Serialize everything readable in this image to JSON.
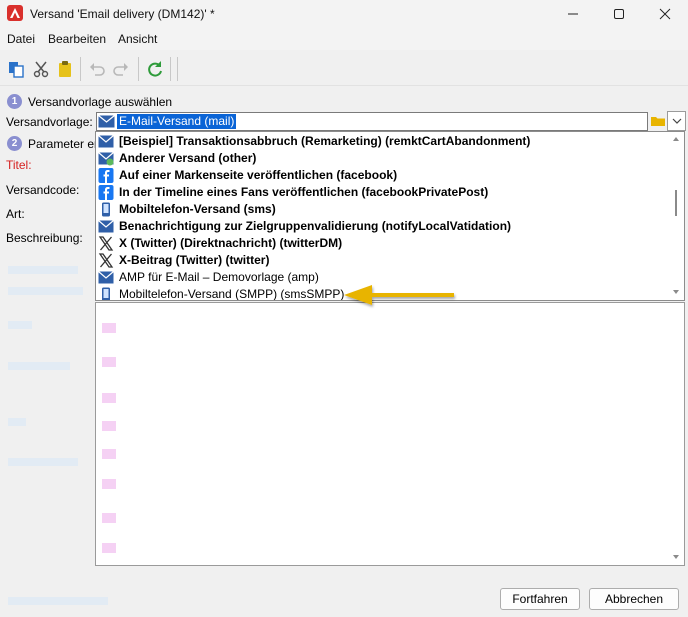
{
  "window": {
    "title": "Versand 'Email delivery (DM142)' *"
  },
  "menu": [
    "Datei",
    "Bearbeiten",
    "Ansicht"
  ],
  "steps": [
    {
      "number": "1",
      "label": "Versandvorlage auswählen"
    },
    {
      "number": "2",
      "label": "Parameter er"
    }
  ],
  "form": {
    "template_label": "Versandvorlage:",
    "selected_template": "E-Mail-Versand (mail)",
    "title_label": "Titel:",
    "code_label": "Versandcode:",
    "type_label": "Art:",
    "description_label": "Beschreibung:"
  },
  "dropdown": {
    "items": [
      {
        "icon": "envelope-icon",
        "label": "[Beispiel] Transaktionsabbruch (Remarketing) (remktCartAbandonment)"
      },
      {
        "icon": "envelope-plus-icon",
        "label": "Anderer Versand (other)"
      },
      {
        "icon": "facebook-icon",
        "label": "Auf einer Markenseite veröffentlichen (facebook)"
      },
      {
        "icon": "facebook-icon",
        "label": "In der Timeline eines Fans veröffentlichen (facebookPrivatePost)"
      },
      {
        "icon": "mobile-phone-icon",
        "label": "Mobiltelefon-Versand (sms)"
      },
      {
        "icon": "envelope-icon",
        "label": "Benachrichtigung zur Zielgruppenvalidierung (notifyLocalVatidation)"
      },
      {
        "icon": "x-twitter-icon",
        "label": "X (Twitter) (Direktnachricht) (twitterDM)"
      },
      {
        "icon": "x-twitter-icon",
        "label": "X-Beitrag (Twitter) (twitter)"
      },
      {
        "icon": "envelope-icon",
        "label": "AMP für E-Mail – Demovorlage (amp)"
      },
      {
        "icon": "mobile-phone-icon",
        "label": "Mobiltelefon-Versand (SMPP) (smsSMPP)"
      }
    ]
  },
  "buttons": {
    "next": "Fortfahren",
    "cancel": "Abbrechen"
  },
  "colors": {
    "accent": "#0a64d6",
    "arrow": "#e8b400",
    "facebook": "#1877f2"
  }
}
